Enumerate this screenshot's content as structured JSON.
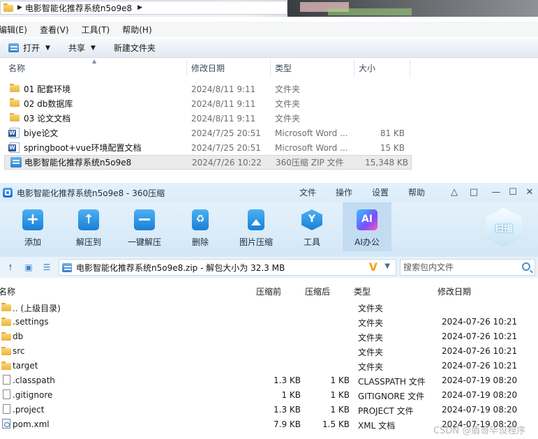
{
  "explorer": {
    "breadcrumb": "电影智能化推荐系统n5o9e8",
    "menu": [
      "编辑(E)",
      "查看(V)",
      "工具(T)",
      "帮助(H)"
    ],
    "toolbar": {
      "open": "打开",
      "share": "共享",
      "new_folder": "新建文件夹"
    },
    "columns": {
      "name": "名称",
      "date": "修改日期",
      "type": "类型",
      "size": "大小"
    },
    "files": [
      {
        "name": "01 配套环境",
        "date": "2024/8/11 9:11",
        "type": "文件夹",
        "size": "",
        "icon": "folder-icon"
      },
      {
        "name": "02 db数据库",
        "date": "2024/8/11 9:11",
        "type": "文件夹",
        "size": "",
        "icon": "folder-icon"
      },
      {
        "name": "03 论文文档",
        "date": "2024/8/11 9:11",
        "type": "文件夹",
        "size": "",
        "icon": "folder-icon"
      },
      {
        "name": "biye论文",
        "date": "2024/7/25 20:51",
        "type": "Microsoft Word ...",
        "size": "81 KB",
        "icon": "word-icon"
      },
      {
        "name": "springboot+vue环境配置文档",
        "date": "2024/7/25 20:51",
        "type": "Microsoft Word ...",
        "size": "15 KB",
        "icon": "word-icon"
      },
      {
        "name": "电影智能化推荐系统n5o9e8",
        "date": "2024/7/26 10:22",
        "type": "360压缩 ZIP 文件",
        "size": "15,348 KB",
        "icon": "zip-icon",
        "selected": true
      }
    ]
  },
  "zip": {
    "title": "电影智能化推荐系统n5o9e8 - 360压缩",
    "menu": {
      "file": "文件",
      "operate": "操作",
      "settings": "设置",
      "help": "帮助"
    },
    "tools": [
      {
        "label": "添加",
        "icon": "add-icon"
      },
      {
        "label": "解压到",
        "icon": "extract-icon"
      },
      {
        "label": "一键解压",
        "icon": "one-key-extract-icon"
      },
      {
        "label": "删除",
        "icon": "delete-icon"
      },
      {
        "label": "图片压缩",
        "icon": "image-compress-icon"
      },
      {
        "label": "工具",
        "icon": "tools-icon"
      },
      {
        "label": "AI办公",
        "icon": "ai-office-icon"
      }
    ],
    "scan_label": "扫描",
    "path": "电影智能化推荐系统n5o9e8.zip - 解包大小为 32.3 MB",
    "search_placeholder": "搜索包内文件",
    "columns": {
      "name": "名称",
      "compressed_before": "压缩前",
      "compressed_after": "压缩后",
      "type": "类型",
      "date": "修改日期"
    },
    "files": [
      {
        "name": ".. (上级目录)",
        "before": "",
        "after": "",
        "type": "文件夹",
        "date": "",
        "icon": "folder-icon"
      },
      {
        "name": ".settings",
        "before": "",
        "after": "",
        "type": "文件夹",
        "date": "2024-07-26 10:21",
        "icon": "folder-icon"
      },
      {
        "name": "db",
        "before": "",
        "after": "",
        "type": "文件夹",
        "date": "2024-07-26 10:21",
        "icon": "folder-icon"
      },
      {
        "name": "src",
        "before": "",
        "after": "",
        "type": "文件夹",
        "date": "2024-07-26 10:21",
        "icon": "folder-icon"
      },
      {
        "name": "target",
        "before": "",
        "after": "",
        "type": "文件夹",
        "date": "2024-07-26 10:21",
        "icon": "folder-icon"
      },
      {
        "name": ".classpath",
        "before": "1.3 KB",
        "after": "1 KB",
        "type": "CLASSPATH 文件",
        "date": "2024-07-19 08:20",
        "icon": "file-icon"
      },
      {
        "name": ".gitignore",
        "before": "1 KB",
        "after": "1 KB",
        "type": "GITIGNORE 文件",
        "date": "2024-07-19 08:20",
        "icon": "file-icon"
      },
      {
        "name": ".project",
        "before": "1.3 KB",
        "after": "1 KB",
        "type": "PROJECT 文件",
        "date": "2024-07-19 08:20",
        "icon": "file-icon"
      },
      {
        "name": "pom.xml",
        "before": "7.9 KB",
        "after": "1.5 KB",
        "type": "XML 文档",
        "date": "2024-07-19 08:20",
        "icon": "xml-icon"
      }
    ]
  },
  "watermark": "CSDN @盾哥毕设程序"
}
